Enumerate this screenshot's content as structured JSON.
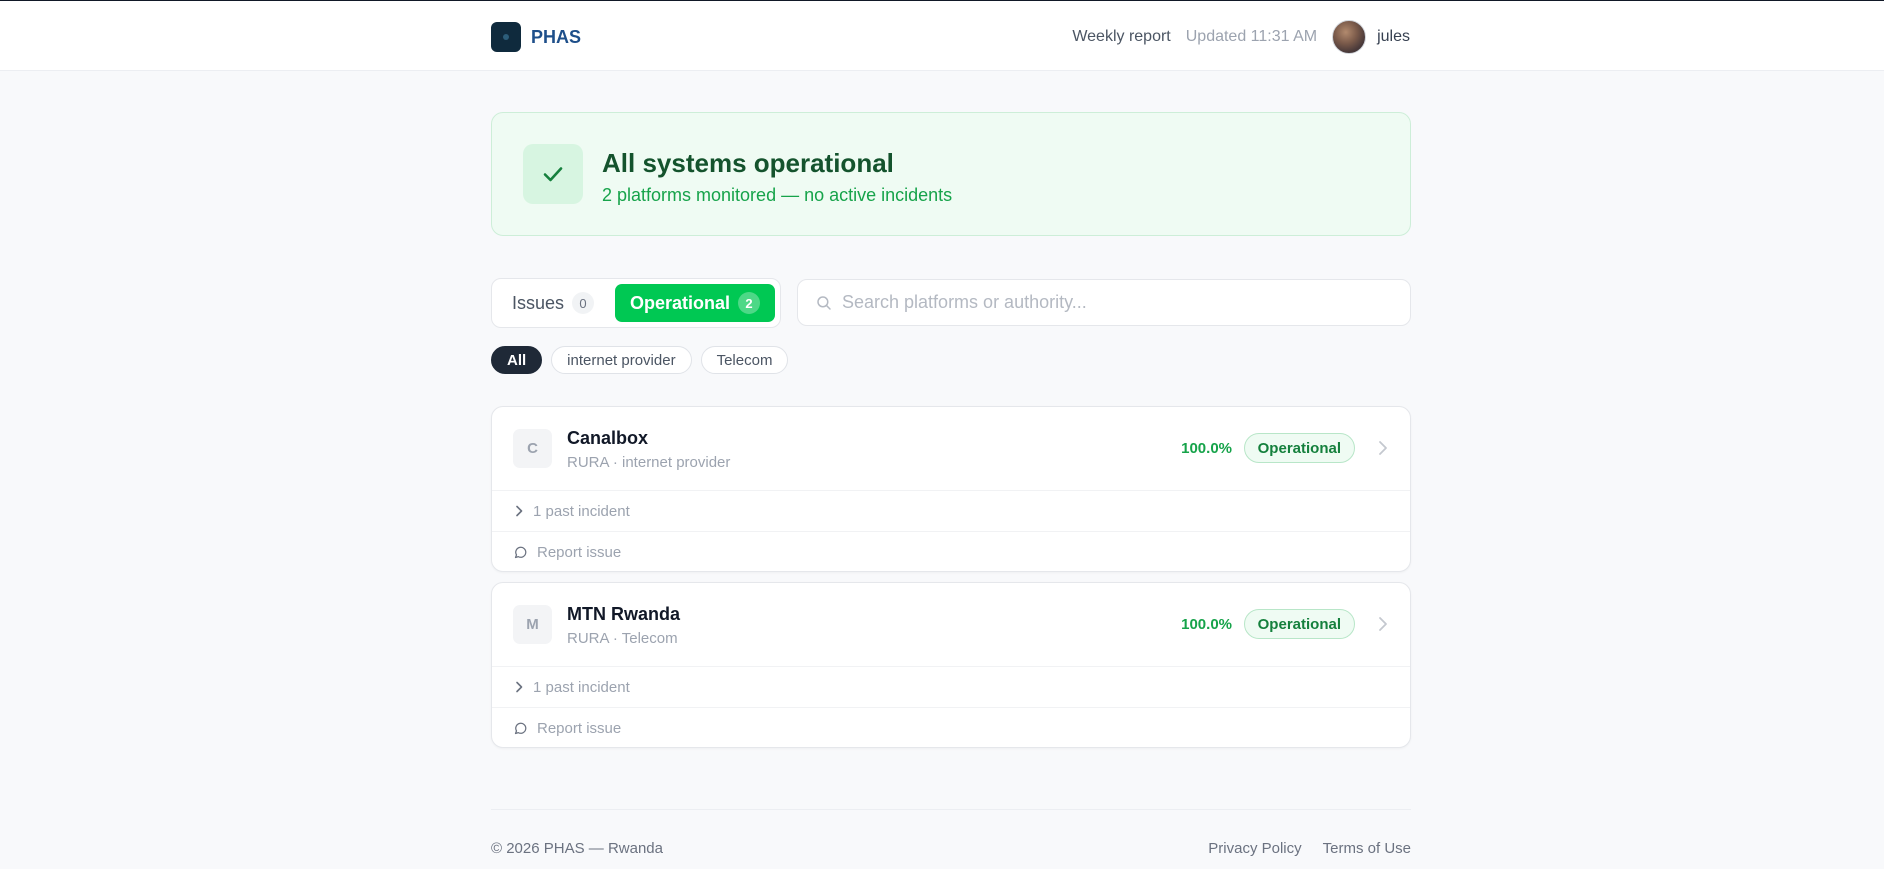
{
  "header": {
    "brand": "PHAS",
    "weekly_report": "Weekly report",
    "updated": "Updated 11:31 AM",
    "username": "jules"
  },
  "banner": {
    "title": "All systems operational",
    "subtitle": "2 platforms monitored — no active incidents",
    "icon": "check-icon"
  },
  "tabs": {
    "issues_label": "Issues",
    "issues_count": "0",
    "operational_label": "Operational",
    "operational_count": "2",
    "selected": "Operational"
  },
  "search": {
    "placeholder": "Search platforms or authority...",
    "value": ""
  },
  "filters": [
    {
      "label": "All",
      "active": true
    },
    {
      "label": "internet provider",
      "active": false
    },
    {
      "label": "Telecom",
      "active": false
    }
  ],
  "platforms": [
    {
      "letter": "C",
      "name": "Canalbox",
      "meta": "RURA · internet provider",
      "uptime": "100.0%",
      "status": "Operational",
      "incidents": "1 past incident",
      "report": "Report issue"
    },
    {
      "letter": "M",
      "name": "MTN Rwanda",
      "meta": "RURA · Telecom",
      "uptime": "100.0%",
      "status": "Operational",
      "incidents": "1 past incident",
      "report": "Report issue"
    }
  ],
  "footer": {
    "copyright": "© 2026 PHAS — Rwanda",
    "privacy": "Privacy Policy",
    "terms": "Terms of Use"
  },
  "colors": {
    "accent": "#00c853",
    "operational_text": "#16a34a",
    "banner_bg": "#effbf3",
    "brand": "#1e4f8a"
  }
}
